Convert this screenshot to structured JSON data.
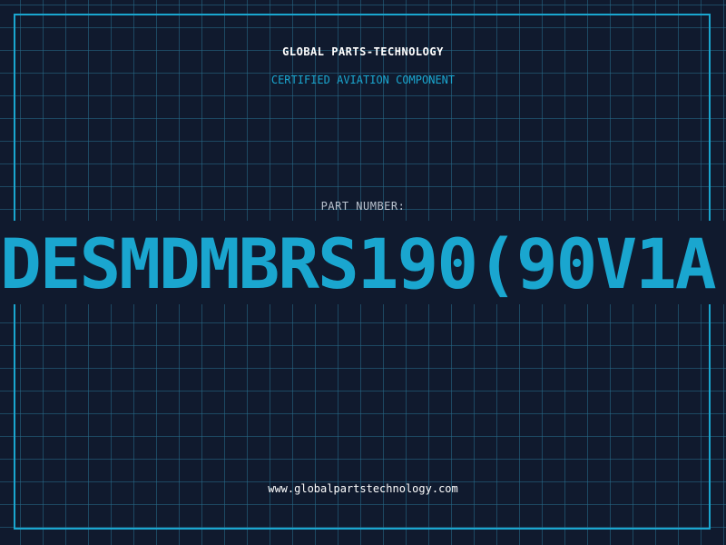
{
  "header": {
    "brand": "GLOBAL PARTS-TECHNOLOGY",
    "subtitle": "CERTIFIED AVIATION COMPONENT"
  },
  "part": {
    "label": "PART NUMBER:",
    "value": "DESMDMBRS190(90V1A"
  },
  "footer": {
    "url": "www.globalpartstechnology.com"
  },
  "colors": {
    "background": "#101a2e",
    "accent": "#1aa6cf",
    "grid": "#286e8c",
    "text": "#ffffff"
  }
}
